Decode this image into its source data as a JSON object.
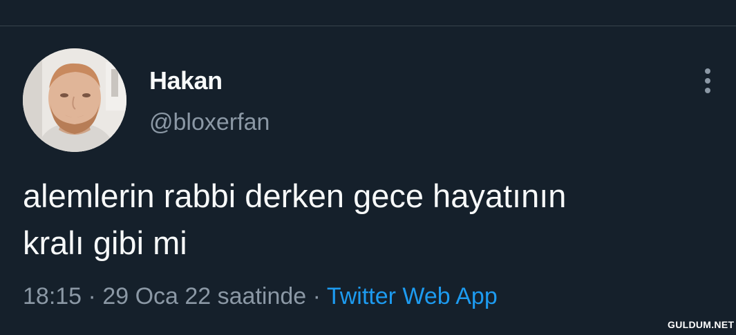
{
  "colors": {
    "background": "#15202b",
    "text_primary": "#f7f9f9",
    "text_secondary": "#8b98a5",
    "link": "#1d9bf0",
    "divider": "#38444d"
  },
  "author": {
    "display_name": "Hakan",
    "handle": "@bloxerfan",
    "avatar_icon": "profile-photo"
  },
  "more_icon": "more-vertical-icon",
  "tweet": {
    "text": "alemlerin rabbi derken gece hayatının\nkralı gibi mi",
    "time": "18:15",
    "separator_1": " · ",
    "date": "29 Oca 22 saatinde",
    "separator_2": " · ",
    "source": "Twitter Web App"
  },
  "watermark": "GULDUM.NET"
}
